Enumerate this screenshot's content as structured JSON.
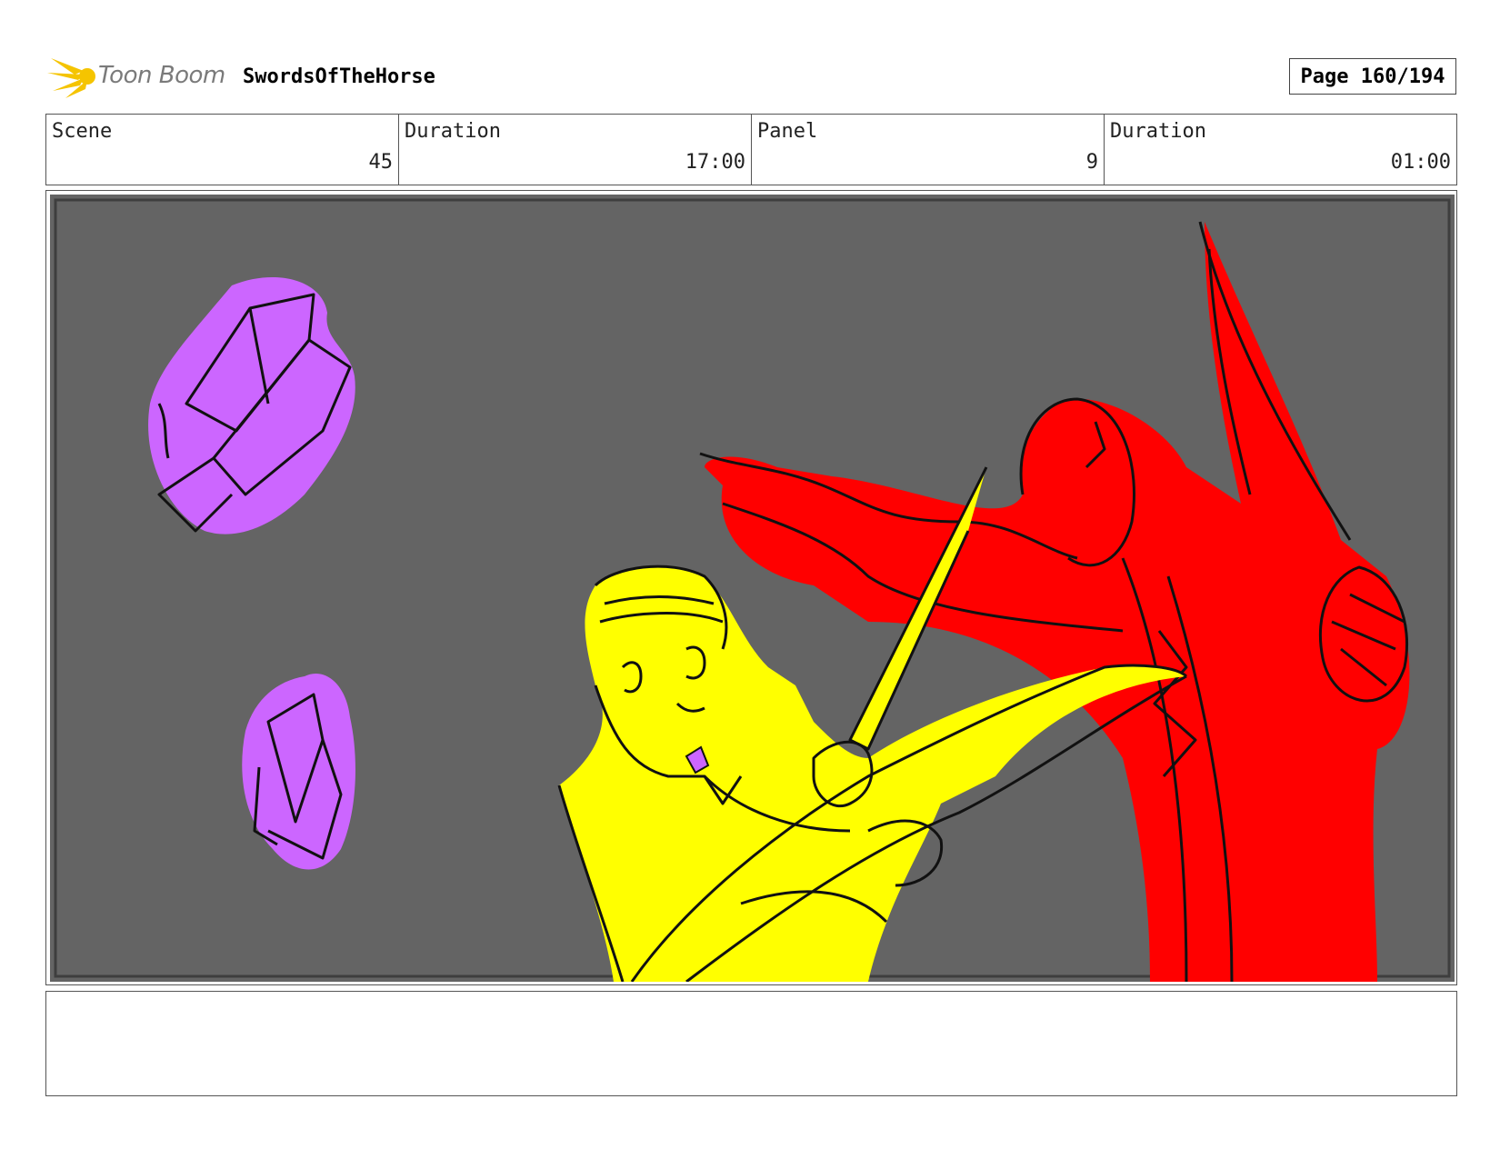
{
  "header": {
    "logo_text": "Toon Boom",
    "project_title": "SwordsOfTheHorse",
    "page_label": "Page 160/194"
  },
  "info": {
    "scene_label": "Scene",
    "scene_value": "45",
    "scene_duration_label": "Duration",
    "scene_duration_value": "17:00",
    "panel_label": "Panel",
    "panel_value": "9",
    "panel_duration_label": "Duration",
    "panel_duration_value": "01:00"
  },
  "notes": {
    "text": ""
  },
  "colors": {
    "background": "#646464",
    "crystal": "#cc66ff",
    "hero": "#ffff00",
    "villain": "#ff0000",
    "logo_accent": "#f5c400"
  }
}
